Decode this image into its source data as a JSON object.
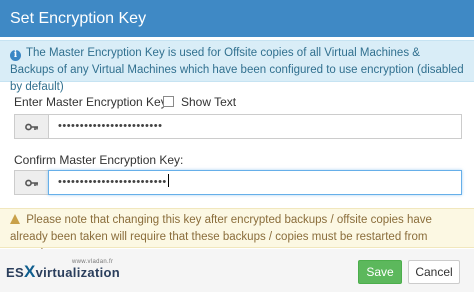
{
  "dialog": {
    "title": "Set Encryption Key"
  },
  "info": {
    "icon": "info-circle-icon",
    "text": "The Master Encryption Key is used for Offsite copies of all Virtual Machines & Backups of any Virtual Machines which have been configured to use encryption (disabled by default)"
  },
  "master_key": {
    "label": "Enter Master Encryption Key:",
    "show_text_label": "Show Text",
    "show_text_checked": false,
    "icon": "key-icon",
    "value": "••••••••••••••••••••••••"
  },
  "confirm_key": {
    "label": "Confirm Master Encryption Key:",
    "icon": "key-icon",
    "value": "•••••••••••••••••••••••••"
  },
  "warning": {
    "icon": "warning-triangle-icon",
    "text": "Please note that changing this key after encrypted backups / offsite copies have already been taken will require that these backups / copies must be restarted from scratch."
  },
  "footer": {
    "watermark_left": "ES",
    "watermark_x": "X",
    "watermark_right": "virtualization",
    "watermark_sub": "www.vladan.fr",
    "save_label": "Save",
    "cancel_label": "Cancel"
  },
  "colors": {
    "title_bar": "#3f89c5",
    "info_bg": "#d9edf7",
    "warning_bg": "#fcf8e3",
    "save_button": "#5cb85c"
  }
}
